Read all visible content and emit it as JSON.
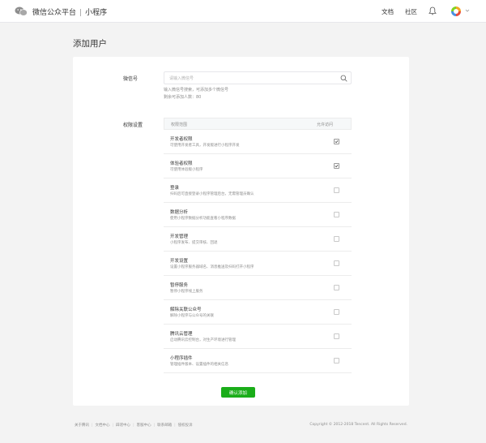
{
  "header": {
    "brand": "微信公众平台",
    "separator": "|",
    "product": "小程序",
    "nav_docs": "文档",
    "nav_community": "社区",
    "icons": [
      "wechat-logo-icon",
      "bell-icon",
      "avatar-icon",
      "chevron-down-icon"
    ]
  },
  "page": {
    "title": "添加用户"
  },
  "form": {
    "wechat_label": "微信号",
    "search_placeholder": "请输入微信号",
    "search_value": "",
    "hint_line1": "输入微信号搜索，可添加多个微信号",
    "hint_line2": "剩余可添加人数：80",
    "permission_label": "权限设置"
  },
  "table": {
    "col_scope": "权限范围",
    "col_allow": "允许访问",
    "rows": [
      {
        "name": "开发者权限",
        "desc": "可使用开发者工具，开发版进行小程序开发",
        "checked": true
      },
      {
        "name": "体验者权限",
        "desc": "可使用体验版小程序",
        "checked": true
      },
      {
        "name": "登录",
        "desc": "扫码后可直接登录小程序管理后台，无需管理员确认",
        "checked": false
      },
      {
        "name": "数据分析",
        "desc": "使用小程序数据分析功能查看小程序数据",
        "checked": false
      },
      {
        "name": "开发管理",
        "desc": "小程序发布、提交审核、回退",
        "checked": false
      },
      {
        "name": "开发设置",
        "desc": "设置小程序服务器域名、消息推送及扫码打开小程序",
        "checked": false
      },
      {
        "name": "暂停服务",
        "desc": "暂停小程序线上服务",
        "checked": false
      },
      {
        "name": "解除关联公众号",
        "desc": "解除小程序与公众号的关联",
        "checked": false
      },
      {
        "name": "腾讯云管理",
        "desc": "启动腾讯云控制台，对生产环境进行管理",
        "checked": false
      },
      {
        "name": "小程序插件",
        "desc": "管理插件版本、设置插件的相关信息",
        "checked": false
      }
    ]
  },
  "actions": {
    "submit_label": "确认添加"
  },
  "footer": {
    "links": [
      "关于腾讯",
      "文档中心",
      "辟谣中心",
      "客服中心",
      "联系邮箱",
      "侵权投诉"
    ],
    "copyright": "Copyright © 2012-2018 Tencent. All Rights Reserved."
  },
  "colors": {
    "primary": "#1aad19",
    "background": "#f3f3f3",
    "card": "#ffffff",
    "border": "#e7e7eb"
  }
}
